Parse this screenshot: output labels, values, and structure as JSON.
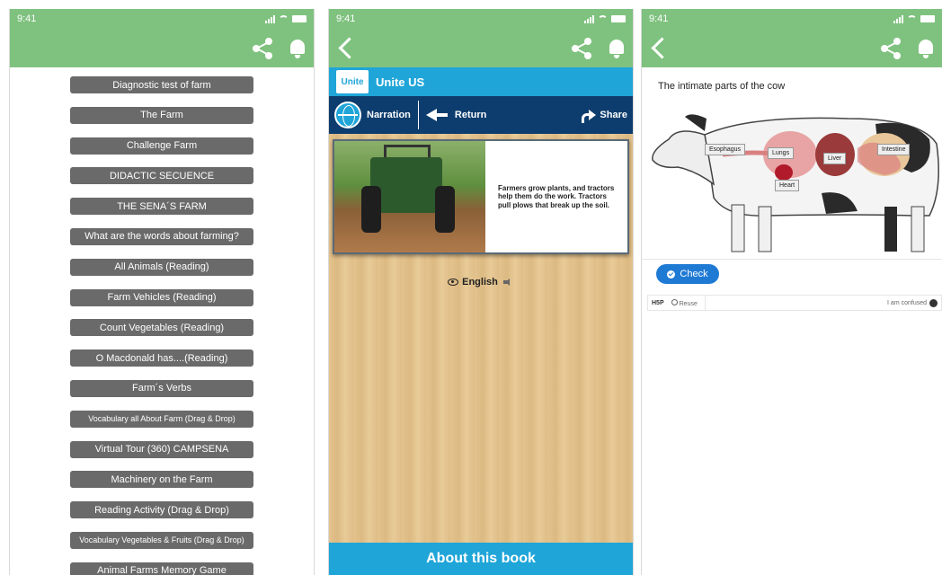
{
  "colors": {
    "header_green": "#7fc27f",
    "menu_button": "#6a6a6a",
    "unite_blue": "#1fa5d8",
    "nav_navy": "#0d3d6e",
    "check_blue": "#1f7ad4"
  },
  "phone1": {
    "status_time": "9:41",
    "menu_items": [
      "Diagnostic test of farm",
      "The Farm",
      "Challenge Farm",
      "DIDACTIC SECUENCE",
      "THE SENA´S FARM",
      "What are the words about farming?",
      "All Animals (Reading)",
      "Farm Vehicles (Reading)",
      "Count Vegetables (Reading)",
      "O Macdonald has....(Reading)",
      "Farm´s Verbs",
      "Vocabulary all About Farm (Drag & Drop)",
      "Virtual Tour (360) CAMPSENA",
      "Machinery on the Farm",
      "Reading  Activity (Drag & Drop)",
      "Vocabulary Vegetables & Fruits (Drag & Drop)",
      "Animal Farms Memory Game"
    ]
  },
  "phone2": {
    "status_time": "9:41",
    "logo_text": "Unite",
    "app_title": "Unite US",
    "nav": {
      "narration": "Narration",
      "return": "Return",
      "share": "Share"
    },
    "book_text": "Farmers grow plants, and tractors help them do the work. Tractors pull plows that break up the soil.",
    "language": "English",
    "about_label": "About this book"
  },
  "phone3": {
    "status_time": "9:41",
    "question": "The intimate parts of the cow",
    "labels": {
      "esophagus": "Esophagus",
      "lungs": "Lungs",
      "liver": "Liver",
      "intestine": "Intestine",
      "heart": "Heart"
    },
    "check_label": "Check",
    "footer": {
      "brand": "H5P",
      "reuse": "Reuse",
      "confused": "I am confused"
    }
  }
}
